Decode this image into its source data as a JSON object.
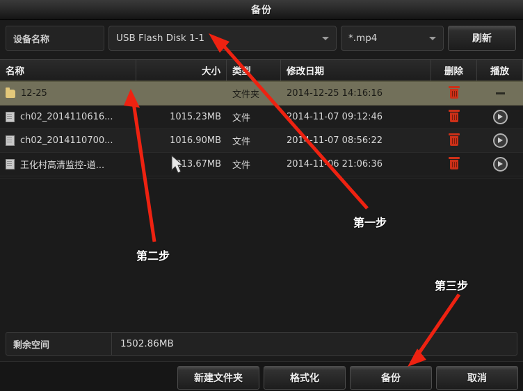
{
  "window": {
    "title": "备份"
  },
  "device_bar": {
    "device_label": "设备名称",
    "device_value": "USB Flash Disk 1-1",
    "filter_value": "*.mp4",
    "refresh_label": "刷新",
    "chevron_icon": "chevron-down-icon"
  },
  "table": {
    "headers": {
      "name": "名称",
      "size": "大小",
      "type": "类型",
      "date": "修改日期",
      "delete": "删除",
      "play": "播放"
    },
    "rows": [
      {
        "icon": "folder-icon",
        "name": "12-25",
        "size": "",
        "type": "文件夹",
        "date": "2014-12-25 14:16:16",
        "delete_icon": "trash-icon",
        "play_icon": "dash-icon",
        "selected": true
      },
      {
        "icon": "file-icon",
        "name": "ch02_2014110616...",
        "size": "1015.23MB",
        "type": "文件",
        "date": "2014-11-07 09:12:46",
        "delete_icon": "trash-icon",
        "play_icon": "play-icon",
        "selected": false
      },
      {
        "icon": "file-icon",
        "name": "ch02_2014110700...",
        "size": "1016.90MB",
        "type": "文件",
        "date": "2014-11-07 08:56:22",
        "delete_icon": "trash-icon",
        "play_icon": "play-icon",
        "selected": false
      },
      {
        "icon": "file-icon",
        "name": "王化村高清监控-道...",
        "size": "213.67MB",
        "type": "文件",
        "date": "2014-11-06 21:06:36",
        "delete_icon": "trash-icon",
        "play_icon": "play-icon",
        "selected": false
      }
    ]
  },
  "free_space": {
    "label": "剩余空间",
    "value": "1502.86MB"
  },
  "footer": {
    "new_folder": "新建文件夹",
    "format": "格式化",
    "backup": "备份",
    "cancel": "取消"
  },
  "annotations": {
    "step1": "第一步",
    "step2": "第二步",
    "step3": "第三步",
    "arrow_color": "#ee2211"
  },
  "colors": {
    "selected_row": "#72705a",
    "window_bg": "#1b1b1b",
    "trash": "#cc3018",
    "folder": "#e3c87a"
  }
}
